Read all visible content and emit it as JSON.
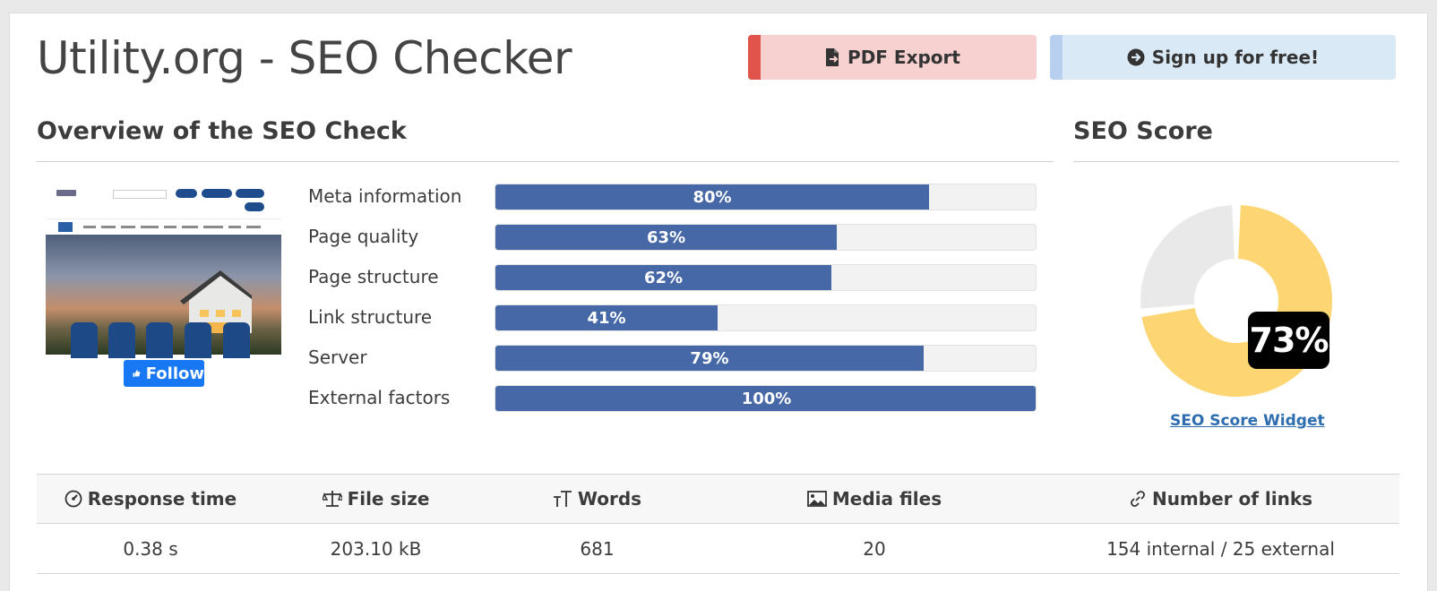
{
  "header": {
    "title": "Utility.org - SEO Checker",
    "pdf_button": "PDF Export",
    "signup_button": "Sign up for free!"
  },
  "overview": {
    "title": "Overview of the SEO Check",
    "follow_label": "Follow",
    "metrics": [
      {
        "label": "Meta information",
        "percent": 80,
        "percent_text": "80%"
      },
      {
        "label": "Page quality",
        "percent": 63,
        "percent_text": "63%"
      },
      {
        "label": "Page structure",
        "percent": 62,
        "percent_text": "62%"
      },
      {
        "label": "Link structure",
        "percent": 41,
        "percent_text": "41%"
      },
      {
        "label": "Server",
        "percent": 79,
        "percent_text": "79%"
      },
      {
        "label": "External factors",
        "percent": 100,
        "percent_text": "100%"
      }
    ]
  },
  "score": {
    "title": "SEO Score",
    "value": 73,
    "value_text": "73%",
    "widget_link": "SEO Score Widget",
    "colors": {
      "filled": "#fdd572",
      "empty": "#e9e9e9"
    }
  },
  "stats": {
    "headers": [
      {
        "label": "Response time",
        "icon": "gauge-icon"
      },
      {
        "label": "File size",
        "icon": "scale-icon"
      },
      {
        "label": "Words",
        "icon": "text-size-icon"
      },
      {
        "label": "Media files",
        "icon": "image-icon"
      },
      {
        "label": "Number of links",
        "icon": "link-icon"
      }
    ],
    "values": [
      "0.38 s",
      "203.10 kB",
      "681",
      "20",
      "154 internal / 25 external"
    ]
  },
  "colors": {
    "bar": "#4668a6",
    "pdf_accent": "#e0544b",
    "pdf_bg": "#f7d0d0",
    "signup_bg": "#d9e9f5",
    "link": "#2d6db0"
  }
}
